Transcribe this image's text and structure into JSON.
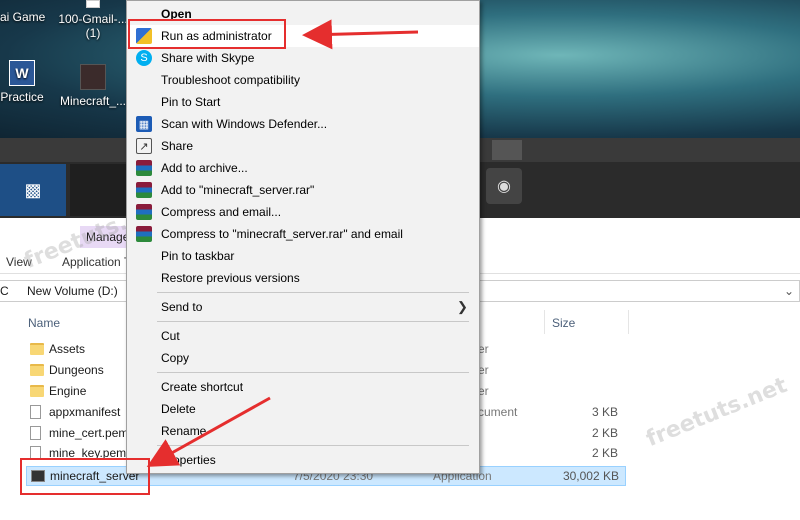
{
  "desktop": {
    "icons": [
      {
        "label": "ai Game"
      },
      {
        "label": "100-Gmail-...\n(1)"
      },
      {
        "label": "Practice"
      },
      {
        "label": "Minecraft_..."
      }
    ]
  },
  "explorer": {
    "manage_tab": "Manage",
    "ribbon_tabs": [
      "View",
      "Application T"
    ],
    "address_path": "New Volume (D:)",
    "address_prefix": "C",
    "columns": {
      "name": "Name",
      "size": "Size"
    },
    "rows": [
      {
        "name": "Assets",
        "date": "",
        "type": "er",
        "size": "",
        "icon": "folder-icon"
      },
      {
        "name": "Dungeons",
        "date": "",
        "type": "er",
        "size": "",
        "icon": "folder-icon"
      },
      {
        "name": "Engine",
        "date": "",
        "type": "er",
        "size": "",
        "icon": "folder-icon"
      },
      {
        "name": "appxmanifest",
        "date": "",
        "type": "cument",
        "size": "3 KB",
        "icon": "file-icon"
      },
      {
        "name": "mine_cert.pem",
        "date": "",
        "type": "",
        "size": "2 KB",
        "icon": "file-icon"
      },
      {
        "name": "mine_key.pem",
        "date": "",
        "type": "",
        "size": "2 KB",
        "icon": "file-icon"
      },
      {
        "name": "minecraft_server",
        "date": "7/5/2020 23:30",
        "type": "Application",
        "size": "30,002 KB",
        "icon": "app-icon"
      }
    ]
  },
  "context_menu": {
    "items": [
      {
        "label": "Open",
        "bold": true,
        "icon": ""
      },
      {
        "label": "Run as administrator",
        "icon": "shield-icon"
      },
      {
        "label": "Share with Skype",
        "icon": "skype-icon"
      },
      {
        "label": "Troubleshoot compatibility",
        "icon": ""
      },
      {
        "label": "Pin to Start",
        "icon": ""
      },
      {
        "label": "Scan with Windows Defender...",
        "icon": "defender-icon"
      },
      {
        "label": "Share",
        "icon": "share-icon"
      },
      {
        "label": "Add to archive...",
        "icon": "winrar-icon"
      },
      {
        "label": "Add to \"minecraft_server.rar\"",
        "icon": "winrar-icon"
      },
      {
        "label": "Compress and email...",
        "icon": "winrar-icon"
      },
      {
        "label": "Compress to \"minecraft_server.rar\" and email",
        "icon": "winrar-icon"
      },
      {
        "label": "Pin to taskbar",
        "icon": ""
      },
      {
        "label": "Restore previous versions",
        "icon": ""
      },
      {
        "label": "Send to",
        "icon": "",
        "submenu": true
      },
      {
        "label": "Cut",
        "icon": ""
      },
      {
        "label": "Copy",
        "icon": ""
      },
      {
        "label": "Create shortcut",
        "icon": ""
      },
      {
        "label": "Delete",
        "icon": ""
      },
      {
        "label": "Rename",
        "icon": ""
      },
      {
        "label": "Properties",
        "icon": ""
      }
    ]
  },
  "watermark": "freetuts.net",
  "colors": {
    "highlight": "#e52e2e",
    "selection": "#cce8ff",
    "menu_bg": "#f2f2f2"
  }
}
